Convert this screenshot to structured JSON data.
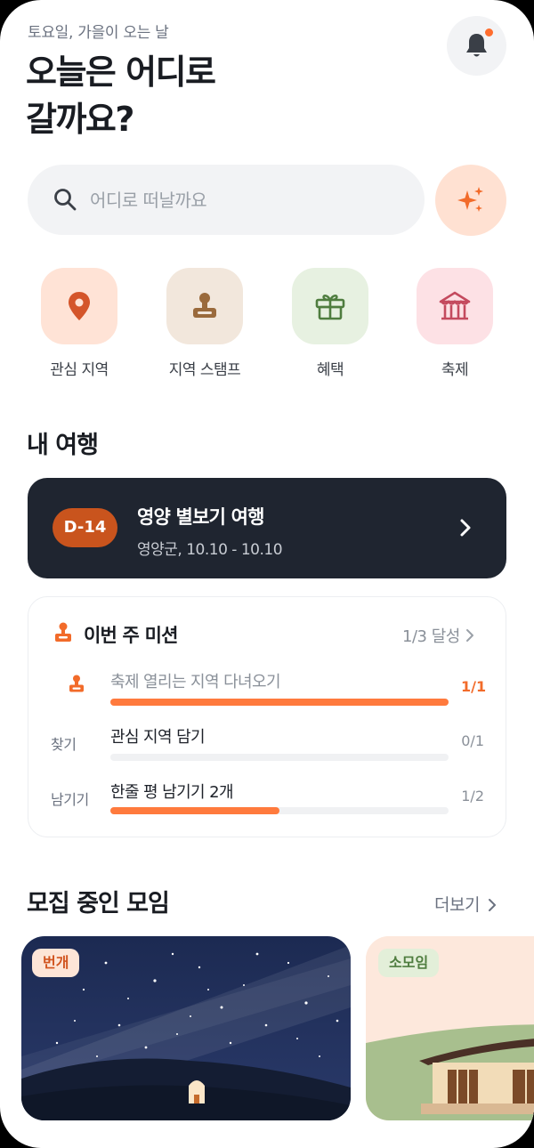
{
  "header": {
    "date_line": "토요일, 가을이 오는 날",
    "headline_line1": "오늘은 어디로",
    "headline_line2": "갈까요?"
  },
  "search": {
    "placeholder": "어디로 떠날까요"
  },
  "quick_menu": [
    {
      "label": "관심 지역",
      "icon": "map-pin-icon",
      "bg": "#ffe3d6",
      "fg": "#d4552a"
    },
    {
      "label": "지역 스탬프",
      "icon": "stamp-icon",
      "bg": "#f2e7dc",
      "fg": "#9a6a3c"
    },
    {
      "label": "혜택",
      "icon": "gift-icon",
      "bg": "#e7f1e1",
      "fg": "#4f7d3f"
    },
    {
      "label": "축제",
      "icon": "festival-tent-icon",
      "bg": "#fde1e5",
      "fg": "#c44a5e"
    }
  ],
  "my_trip": {
    "section_title": "내 여행",
    "dday": "D-14",
    "title": "영양 별보기 여행",
    "subtitle": "영양군, 10.10 - 10.10"
  },
  "missions": {
    "title": "이번 주 미션",
    "progress_label": "1/3 달성",
    "items": [
      {
        "left": "",
        "name": "축제 열리는 지역 다녀오기",
        "count": "1/1",
        "progress": 1.0,
        "done": true
      },
      {
        "left": "찾기",
        "name": "관심 지역 담기",
        "count": "0/1",
        "progress": 0.0,
        "done": false
      },
      {
        "left": "남기기",
        "name": "한줄 평 남기기 2개",
        "count": "1/2",
        "progress": 0.5,
        "done": false
      }
    ]
  },
  "groups": {
    "section_title": "모집 중인 모임",
    "more_label": "더보기",
    "cards": [
      {
        "tag": "번개"
      },
      {
        "tag": "소모임"
      }
    ]
  },
  "colors": {
    "accent": "#ff6d2e",
    "dark_card": "#1f2530"
  }
}
